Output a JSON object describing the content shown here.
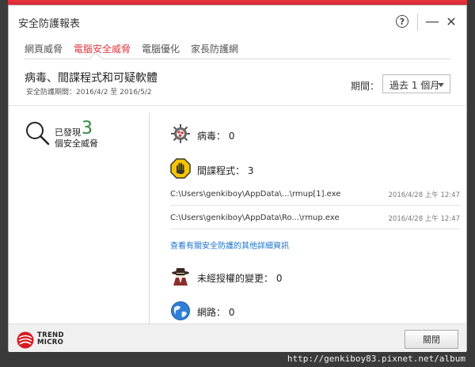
{
  "window": {
    "title": "安全防護報表"
  },
  "tabs": [
    {
      "label": "網頁威脅"
    },
    {
      "label": "電腦安全威脅"
    },
    {
      "label": "電腦優化"
    },
    {
      "label": "家長防護網"
    }
  ],
  "report": {
    "heading": "病毒、間諜程式和可疑軟體",
    "period_text": "安全防護期間：2016/4/2 至 2016/5/2",
    "period_label": "期間：",
    "period_value": "過去 1 個月"
  },
  "summary": {
    "line1": "已發現",
    "count": "3",
    "line2": "個安全威脅"
  },
  "items": {
    "virus": "病毒： 0",
    "spyware": "間諜程式： 3",
    "unauthorized": "未經授權的變更： 0",
    "network": "網路： 0"
  },
  "files": [
    {
      "path": "C:\\Users\\genkiboy\\AppData\\...\\rmup[1].exe",
      "date": "2016/4/28 上午 12:47"
    },
    {
      "path": "C:\\Users\\genkiboy\\AppData\\Ro...\\rmup.exe",
      "date": "2016/4/28 上午 12:47"
    }
  ],
  "details_link": "查看有關安全防護的其他詳細資訊",
  "footer": {
    "logo_line1": "TREND",
    "logo_line2": "MICRO",
    "close_label": "關閉"
  },
  "icons": {
    "help": "help-icon",
    "minimize": "minimize-icon",
    "close": "close-icon",
    "magnifier": "magnifier-icon",
    "virus": "virus-icon",
    "spyware": "hand-stop-icon",
    "spy": "spy-icon",
    "network": "globe-icon"
  },
  "colors": {
    "accent": "#e0393f",
    "count_green": "#2e8b3a",
    "link_blue": "#1a73c8"
  },
  "watermark": "http://genkiboy83.pixnet.net/album"
}
